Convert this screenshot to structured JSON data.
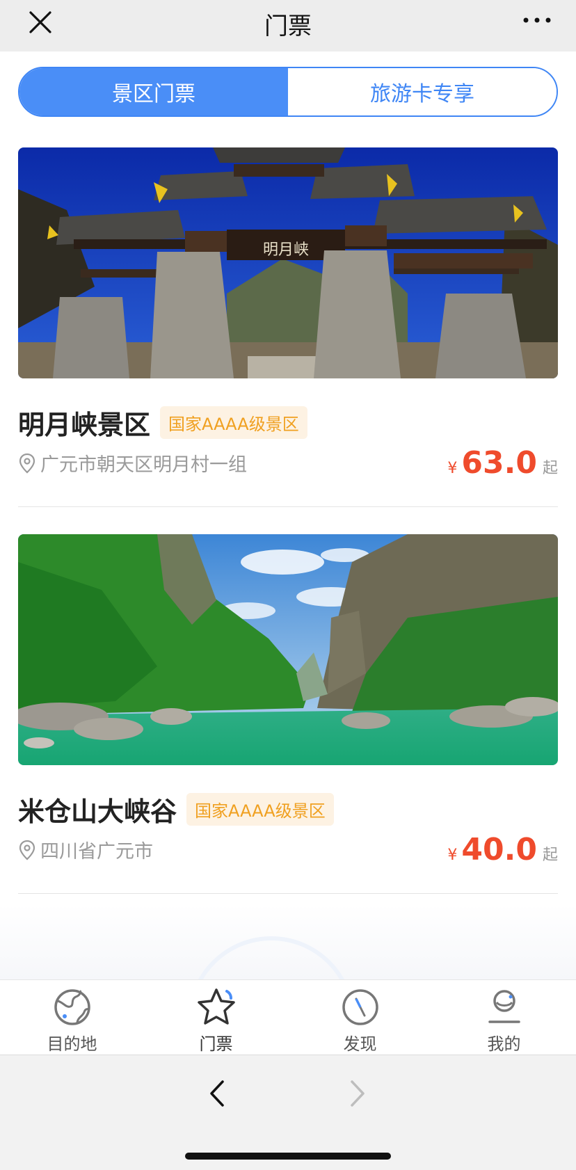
{
  "header": {
    "title": "门票"
  },
  "tabs": [
    {
      "label": "景区门票",
      "active": true
    },
    {
      "label": "旅游卡专享",
      "active": false
    }
  ],
  "attractions": [
    {
      "name": "明月峡景区",
      "badge": "国家AAAA级景区",
      "address": "广元市朝天区明月村一组",
      "currency": "¥",
      "price": "63.0",
      "unit": "起",
      "gate_sign": "明月峡"
    },
    {
      "name": "米仓山大峡谷",
      "badge": "国家AAAA级景区",
      "address": "四川省广元市",
      "currency": "¥",
      "price": "40.0",
      "unit": "起"
    }
  ],
  "tabbar": [
    {
      "label": "目的地",
      "icon": "globe-icon"
    },
    {
      "label": "门票",
      "icon": "star-icon",
      "active": true
    },
    {
      "label": "发现",
      "icon": "compass-icon"
    },
    {
      "label": "我的",
      "icon": "user-icon"
    }
  ],
  "colors": {
    "accent": "#4a8ef7",
    "price": "#ef4b2c",
    "badge_text": "#f0a020",
    "badge_bg": "#fdf2e3"
  }
}
